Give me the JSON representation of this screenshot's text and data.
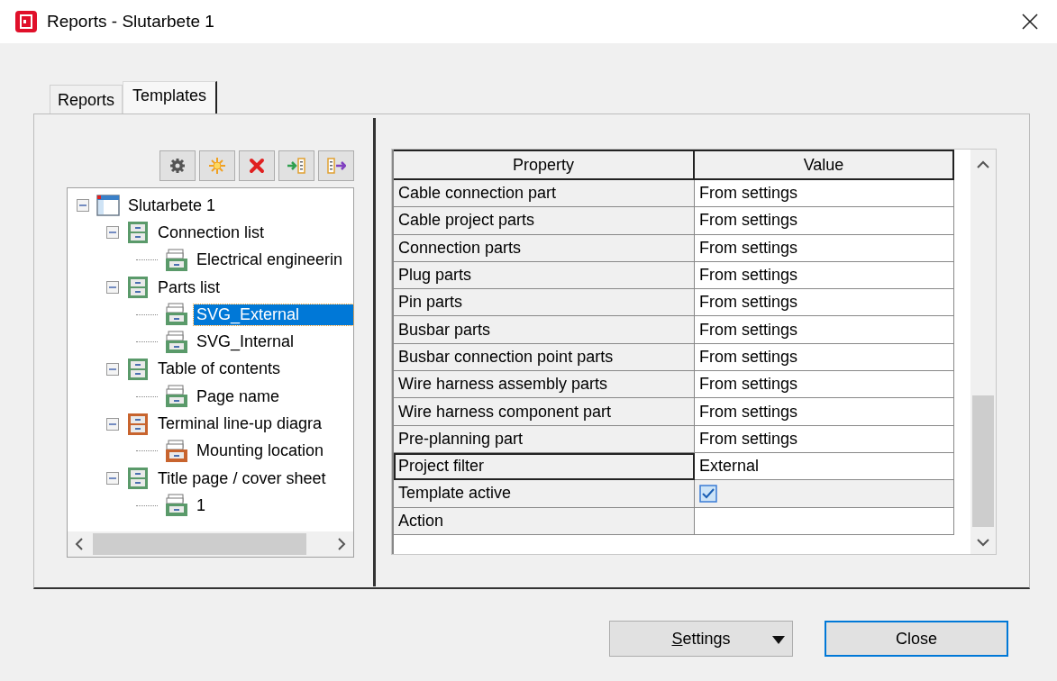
{
  "window": {
    "title": "Reports - Slutarbete 1"
  },
  "tabs": [
    {
      "label": "Reports",
      "selected": false
    },
    {
      "label": "Templates",
      "selected": true
    }
  ],
  "toolbar": [
    {
      "kind": "settings"
    },
    {
      "kind": "new"
    },
    {
      "kind": "delete"
    },
    {
      "kind": "import"
    },
    {
      "kind": "export"
    }
  ],
  "tree": [
    {
      "label": "Slutarbete 1",
      "kind": "project",
      "expanded": true,
      "selected": false,
      "children": [
        {
          "label": "Connection list",
          "kind": "report",
          "color": "#5a9a6a",
          "expanded": true,
          "selected": false,
          "children": [
            {
              "label": "Electrical engineerin",
              "kind": "template",
              "color": "#5a9a6a",
              "selected": false
            }
          ]
        },
        {
          "label": "Parts list",
          "kind": "report",
          "color": "#5a9a6a",
          "expanded": true,
          "selected": false,
          "children": [
            {
              "label": "SVG_External",
              "kind": "template",
              "color": "#5a9a6a",
              "selected": true
            },
            {
              "label": "SVG_Internal",
              "kind": "template",
              "color": "#5a9a6a",
              "selected": false
            }
          ]
        },
        {
          "label": "Table of contents",
          "kind": "report",
          "color": "#5a9a6a",
          "expanded": true,
          "selected": false,
          "children": [
            {
              "label": "Page name",
              "kind": "template",
              "color": "#5a9a6a",
              "selected": false
            }
          ]
        },
        {
          "label": "Terminal line-up diagra",
          "kind": "report",
          "color": "#c8642e",
          "expanded": true,
          "selected": false,
          "children": [
            {
              "label": "Mounting location",
              "kind": "template",
              "color": "#c8642e",
              "selected": false
            }
          ]
        },
        {
          "label": "Title page / cover sheet",
          "kind": "report",
          "color": "#5a9a6a",
          "expanded": true,
          "selected": false,
          "children": [
            {
              "label": "1",
              "kind": "template",
              "color": "#5a9a6a",
              "selected": false
            }
          ]
        }
      ]
    }
  ],
  "grid": {
    "columns": [
      "Property",
      "Value"
    ],
    "rows": [
      {
        "property": "Cable connection part",
        "kind": "text",
        "value": "From settings",
        "selected": false
      },
      {
        "property": "Cable project parts",
        "kind": "text",
        "value": "From settings",
        "selected": false
      },
      {
        "property": "Connection parts",
        "kind": "text",
        "value": "From settings",
        "selected": false
      },
      {
        "property": "Plug parts",
        "kind": "text",
        "value": "From settings",
        "selected": false
      },
      {
        "property": "Pin parts",
        "kind": "text",
        "value": "From settings",
        "selected": false
      },
      {
        "property": "Busbar parts",
        "kind": "text",
        "value": "From settings",
        "selected": false
      },
      {
        "property": "Busbar connection point parts",
        "kind": "text",
        "value": "From settings",
        "selected": false
      },
      {
        "property": "Wire harness assembly parts",
        "kind": "text",
        "value": "From settings",
        "selected": false
      },
      {
        "property": "Wire harness component part",
        "kind": "text",
        "value": "From settings",
        "selected": false
      },
      {
        "property": "Pre-planning part",
        "kind": "text",
        "value": "From settings",
        "selected": false
      },
      {
        "property": "Project filter",
        "kind": "text",
        "value": "External",
        "selected": true
      },
      {
        "property": "Template active",
        "kind": "checkbox",
        "checked": true,
        "selected": false
      },
      {
        "property": "Action",
        "kind": "text",
        "selected": false
      }
    ]
  },
  "buttons": {
    "settings": "Settings",
    "close": "Close"
  }
}
